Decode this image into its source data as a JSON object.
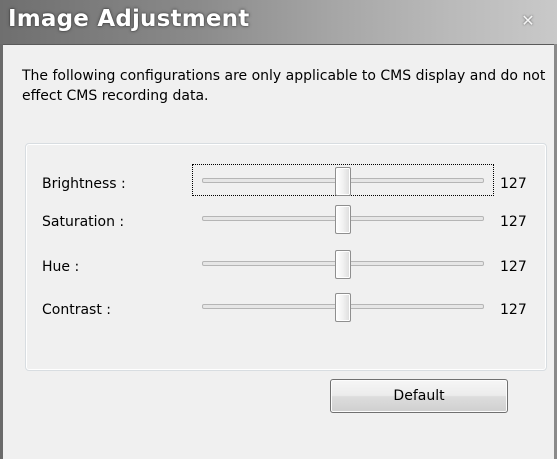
{
  "window": {
    "title": "Image Adjustment",
    "close_label": "✕"
  },
  "description": "The following configurations are only applicable to CMS display and do not effect CMS recording data.",
  "sliders": [
    {
      "label": "Brightness :",
      "value": "127",
      "level": 127,
      "max": 255
    },
    {
      "label": "Saturation :",
      "value": "127",
      "level": 127,
      "max": 255
    },
    {
      "label": "Hue :",
      "value": "127",
      "level": 127,
      "max": 255
    },
    {
      "label": "Contrast :",
      "value": "127",
      "level": 127,
      "max": 255
    }
  ],
  "default_button_label": "Default"
}
